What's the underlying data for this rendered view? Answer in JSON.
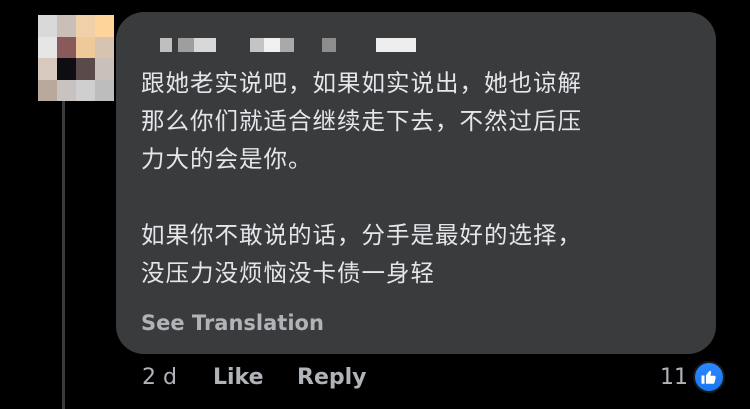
{
  "comment": {
    "lines": [
      "跟她老实说吧，如果如实说出，她也谅解",
      "那么你们就适合继续走下去，不然过后压",
      "力大的会是你。",
      "如果你不敢说的话，分手是最好的选择，",
      "没压力没烦恼没卡债一身轻"
    ],
    "see_translation": "See Translation"
  },
  "actions": {
    "time": "2 d",
    "like": "Like",
    "reply": "Reply",
    "reaction_count": "11"
  },
  "colors": {
    "background": "#000000",
    "bubble": "#3a3b3c",
    "text": "#e4e6eb",
    "muted": "#b0b3b8",
    "like_blue": "#1877f2"
  },
  "icons": {
    "avatar": "pixelated-avatar",
    "reaction": "thumbs-up-icon"
  }
}
